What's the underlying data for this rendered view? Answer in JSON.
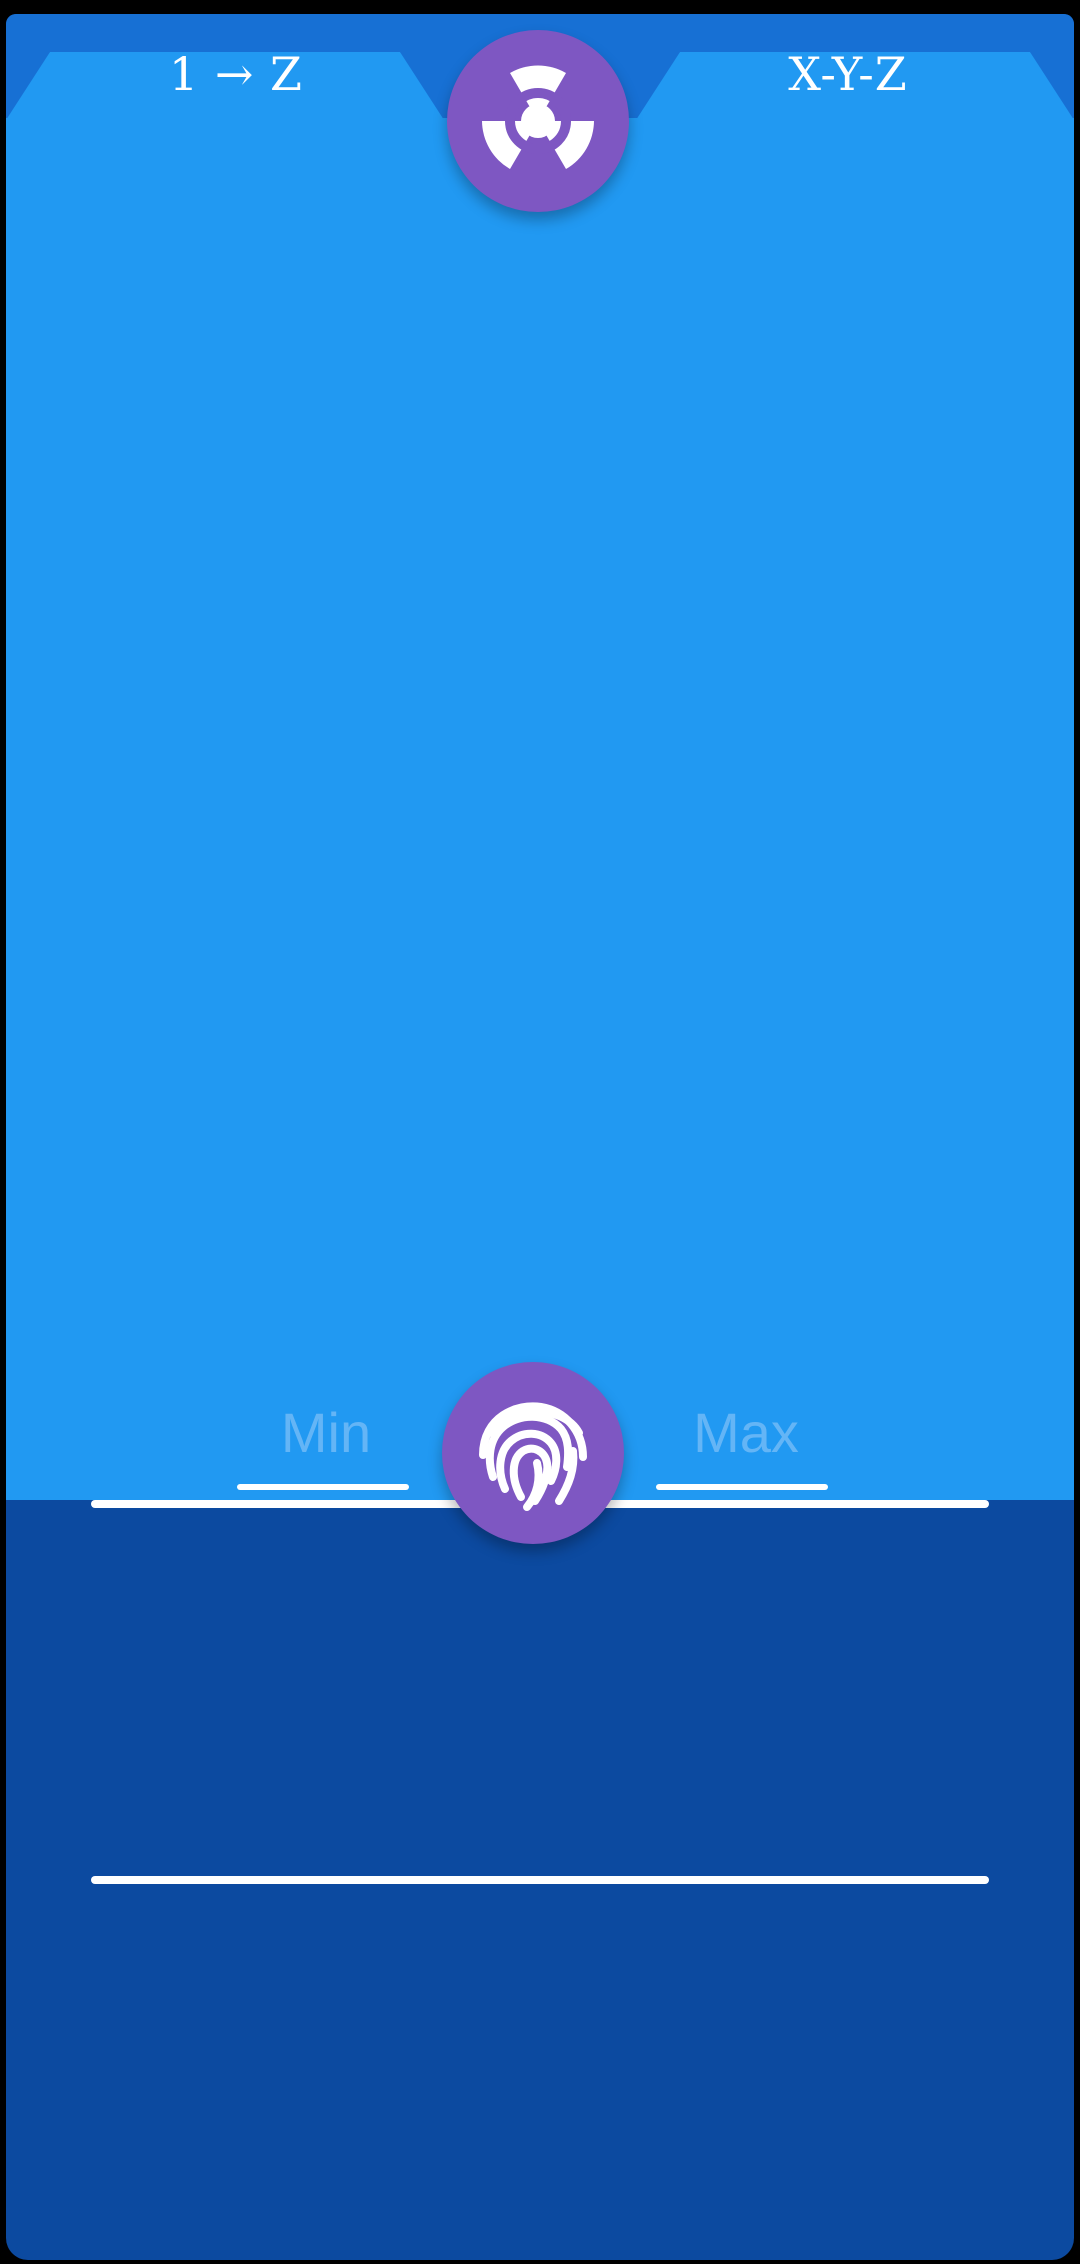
{
  "tabs": {
    "left_label": "1 → Z",
    "right_label": "X-Y-Z"
  },
  "controls": {
    "min_label": "Min",
    "max_label": "Max"
  },
  "icons": {
    "top_fab": "radioactive-icon",
    "bottom_fab": "fingerprint-icon"
  },
  "colors": {
    "header_blue": "#1770d4",
    "panel_blue": "#2199f2",
    "lower_blue": "#0c4aa0",
    "fab_purple": "#7e57c2",
    "label_blue": "#64b5f6",
    "white": "#ffffff"
  }
}
